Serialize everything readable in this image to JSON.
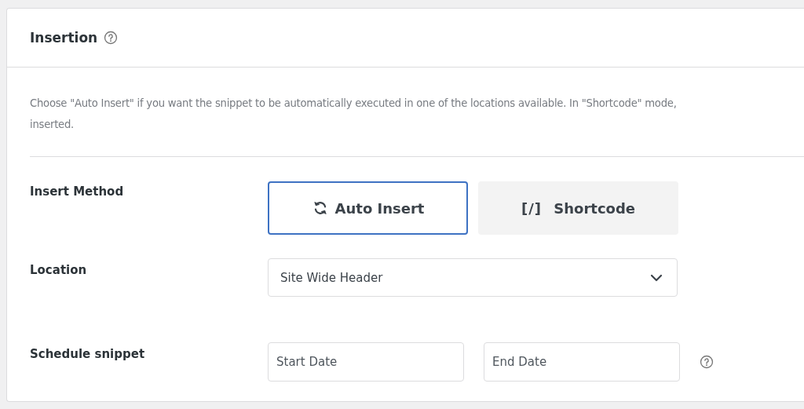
{
  "panel": {
    "title": "Insertion",
    "help": true,
    "description": [
      "Choose \"Auto Insert\" if you want the snippet to be automatically executed in one of the locations available. In \"Shortcode\" mode,",
      "inserted."
    ]
  },
  "rows": [
    {
      "kind": "methods",
      "label": "Insert Method",
      "options": [
        {
          "label": "Auto Insert",
          "selected": true
        },
        {
          "symbol": "[/]",
          "label": "Shortcode",
          "selected": false
        }
      ]
    },
    {
      "kind": "select",
      "label": "Location",
      "value": "Site Wide Header"
    },
    {
      "kind": "dates",
      "label": "Schedule snippet",
      "fields": [
        {
          "placeholder": "Start Date"
        },
        {
          "placeholder": "End Date"
        }
      ],
      "help": true
    }
  ]
}
